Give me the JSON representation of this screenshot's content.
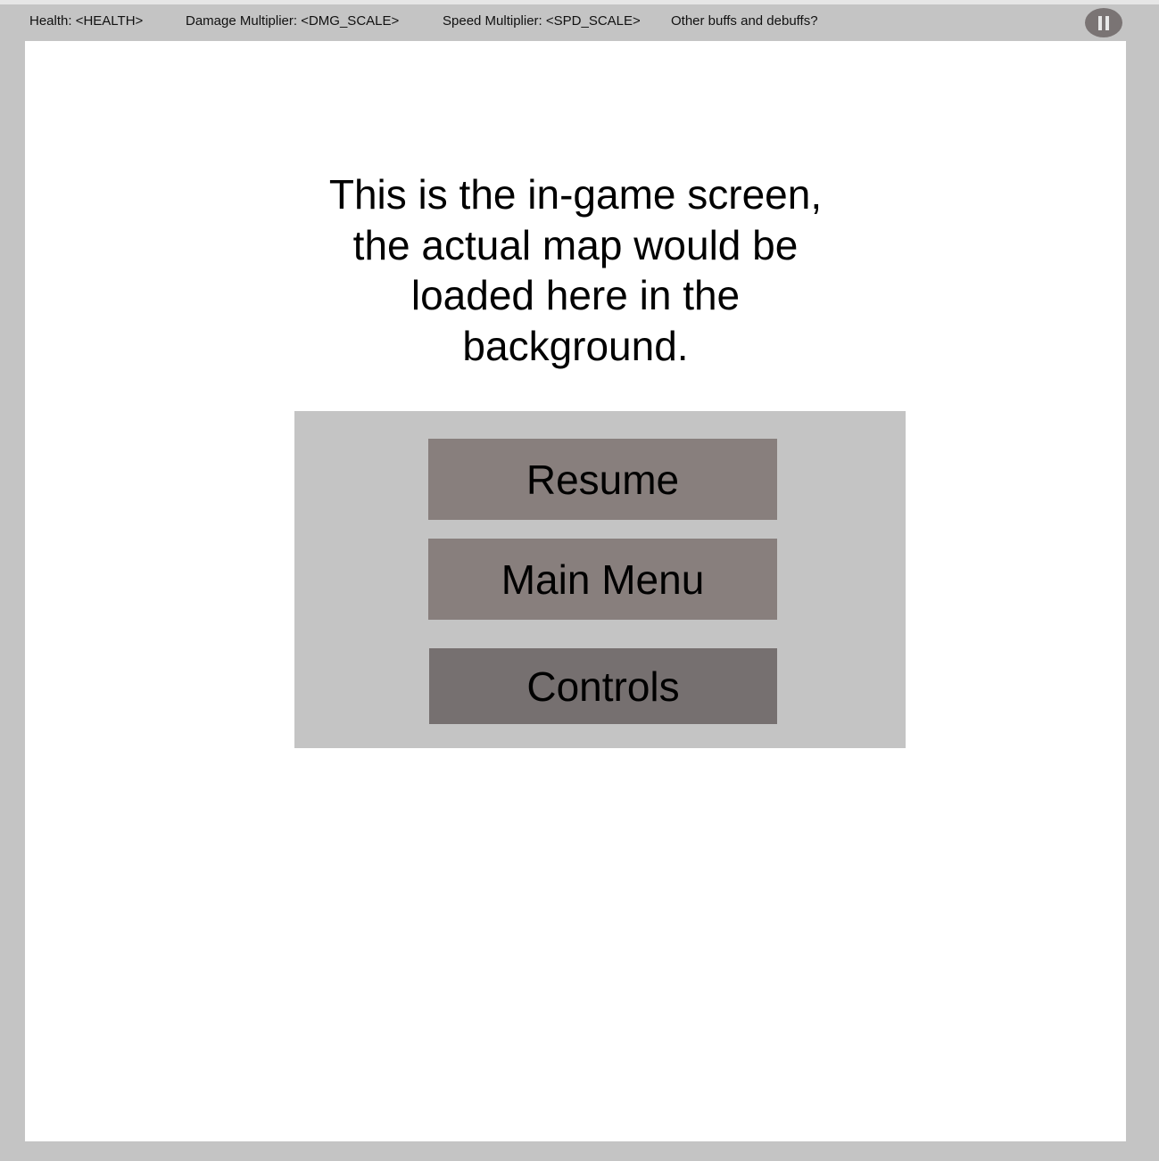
{
  "hud": {
    "health": "Health: <HEALTH>",
    "damage_multiplier": "Damage Multiplier: <DMG_SCALE>",
    "speed_multiplier": "Speed Multiplier: <SPD_SCALE>",
    "other_effects": "Other buffs and debuffs?",
    "pause_icon": "pause-icon"
  },
  "main": {
    "placeholder_lines": [
      "This is the in-game screen,",
      "the actual map would be",
      "loaded here in the",
      "background."
    ]
  },
  "pause_menu": {
    "resume_label": "Resume",
    "main_menu_label": "Main Menu",
    "controls_label": "Controls"
  },
  "colors": {
    "background": "#c4c4c4",
    "game_area": "#ffffff",
    "button": "#887f7d",
    "controls_button": "#767070",
    "pause_button": "#7a7474"
  }
}
